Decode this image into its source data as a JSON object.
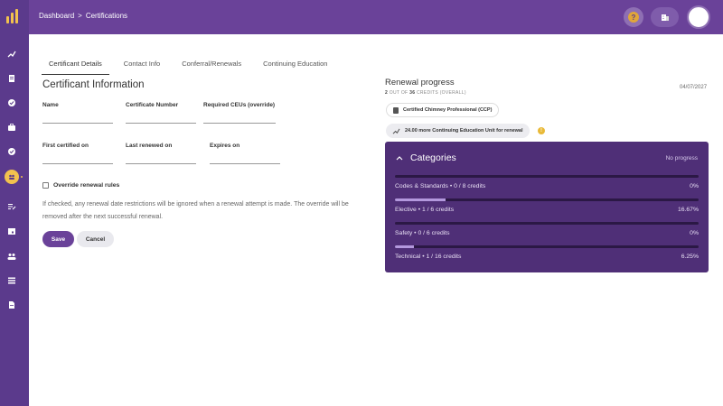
{
  "breadcrumb": {
    "root": "Dashboard",
    "separator": ">",
    "current": "Certifications"
  },
  "header": {
    "help_icon_text": "?",
    "avatar_initial": ""
  },
  "sidebar": {
    "icons": [
      "trend-icon",
      "document-icon",
      "badge-icon",
      "briefcase-icon",
      "checklist-icon",
      "group-icon",
      "edit-list-icon",
      "calendar-icon",
      "people-icon",
      "list-icon",
      "file-icon"
    ]
  },
  "tabs": [
    {
      "label": "Certificant Details",
      "active": true
    },
    {
      "label": "Contact Info",
      "active": false
    },
    {
      "label": "Conferral/Renewals",
      "active": false
    },
    {
      "label": "Continuing Education",
      "active": false
    }
  ],
  "form": {
    "title": "Certificant Information",
    "fields": {
      "name": {
        "label": "Name",
        "value": ""
      },
      "certificate_number": {
        "label": "Certificate Number",
        "value": ""
      },
      "required_ceus": {
        "label": "Required CEUs (override)",
        "value": ""
      },
      "first_certified": {
        "label": "First certified on",
        "value": ""
      },
      "last_renewed": {
        "label": "Last renewed on",
        "value": ""
      },
      "expires": {
        "label": "Expires on",
        "value": ""
      }
    },
    "override_label": "Override renewal rules",
    "override_checked": false,
    "help_text": "If checked, any renewal date restrictions will be ignored when a renewal attempt is made. The override will be removed after the next successful renewal.",
    "save_label": "Save",
    "cancel_label": "Cancel"
  },
  "renewal": {
    "title": "Renewal progress",
    "credits_earned": "2",
    "credits_mid": "OUT OF",
    "credits_total": "36",
    "credits_suffix": "CREDITS (OVERALL)",
    "date": "04/07/2027",
    "certification": "Certified Chimney Professional (CCP)",
    "needed": "24.00 more Continuing Education Unit for renewal",
    "warning_glyph": "!"
  },
  "categories": {
    "title": "Categories",
    "status": "No progress",
    "rows": [
      {
        "name": "Codes & Standards",
        "credits": "0 / 8 credits",
        "percent": "0%",
        "fraction": 0
      },
      {
        "name": "Elective",
        "credits": "1 / 6 credits",
        "percent": "16.67%",
        "fraction": 0.1667
      },
      {
        "name": "Safety",
        "credits": "0 / 6 credits",
        "percent": "0%",
        "fraction": 0
      },
      {
        "name": "Technical",
        "credits": "1 / 16 credits",
        "percent": "6.25%",
        "fraction": 0.0625
      }
    ]
  },
  "colors": {
    "brand": "#6a4299",
    "sidebar": "#5b3a8c",
    "accent": "#f2c14e",
    "card": "#4f2f77"
  }
}
